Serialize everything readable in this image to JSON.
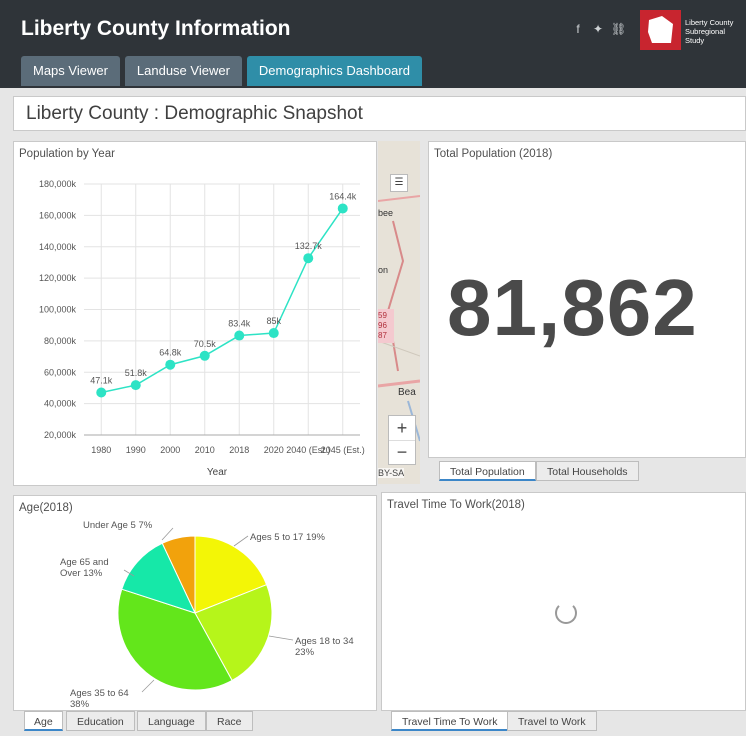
{
  "header": {
    "title": "Liberty County Information",
    "logo_text": "Liberty County Subregional Study",
    "icons": [
      "facebook-icon",
      "twitter-icon",
      "link-icon"
    ],
    "colors": {
      "header_bg": "#2f3439",
      "active_tab": "#2f8ea8",
      "tab": "#5b6c79",
      "logo": "#c8252f"
    }
  },
  "tabs": [
    {
      "label": "Maps Viewer"
    },
    {
      "label": "Landuse Viewer"
    },
    {
      "label": "Demographics Dashboard",
      "active": true
    }
  ],
  "page_title": "Liberty County : Demographic Snapshot",
  "population_panel": {
    "title": "Population by Year"
  },
  "total_population_panel": {
    "title": "Total Population (2018)",
    "value": "81,862",
    "tabs": [
      "Total Population",
      "Total Households"
    ]
  },
  "map_panel": {
    "attribution": "BY-SA",
    "labels": [
      "bee",
      "on",
      "59",
      "96",
      "87",
      "Bea"
    ],
    "zoom_in": "+",
    "zoom_out": "−"
  },
  "age_panel": {
    "title": "Age(2018)",
    "tabs": [
      "Age",
      "Education",
      "Language",
      "Race"
    ]
  },
  "travel_panel": {
    "title": "Travel Time To Work(2018)",
    "tabs": [
      "Travel Time To Work",
      "Travel to Work"
    ]
  },
  "chart_data": [
    {
      "type": "line",
      "title": "Population by Year",
      "xlabel": "Year",
      "ylabel": "",
      "categories": [
        "1980",
        "1990",
        "2000",
        "2010",
        "2018",
        "2020",
        "2040 (Est.)",
        "2045 (Est.)"
      ],
      "values": [
        47100,
        51800,
        64800,
        70500,
        83400,
        85000,
        132700,
        164400
      ],
      "data_labels": [
        "47.1k",
        "51.8k",
        "64.8k",
        "70.5k",
        "83.4k",
        "85k",
        "132.7k",
        "164.4k"
      ],
      "ylim": [
        20000,
        180000
      ],
      "yticks": [
        "20,000k",
        "40,000k",
        "60,000k",
        "80,000k",
        "100,000k",
        "120,000k",
        "140,000k",
        "160,000k",
        "180,000k"
      ],
      "color": "#2de3c5",
      "grid": true
    },
    {
      "type": "pie",
      "title": "Age(2018)",
      "slices": [
        {
          "label": "Under Age 5",
          "value": 7,
          "text": "Under Age 5 7%",
          "color": "#f2a20c"
        },
        {
          "label": "Ages 5 to 17",
          "value": 19,
          "text": "Ages 5 to 17 19%",
          "color": "#f3f606"
        },
        {
          "label": "Ages 18 to 34",
          "value": 23,
          "text": "Ages 18 to 34 23%",
          "color": "#b6f51a"
        },
        {
          "label": "Ages 35 to 64",
          "value": 38,
          "text": "Ages 35 to 64 38%",
          "color": "#63e61b"
        },
        {
          "label": "Age 65 and Over",
          "value": 13,
          "text": "Age 65 and Over 13%",
          "color": "#16e8a8"
        }
      ]
    }
  ]
}
